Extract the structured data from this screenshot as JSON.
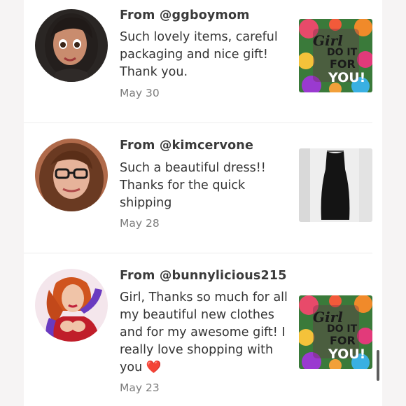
{
  "reviews": [
    {
      "from": "From @ggboymom",
      "text": "Such lovely items, careful packaging and nice gift! Thank you.",
      "date": "May 30",
      "avatar_icon": "cartoon-woman-avatar",
      "thumbnail_icon": "girl-do-it-for-you-art-thumbnail"
    },
    {
      "from": "From @kimcervone",
      "text": "Such a beautiful dress!! Thanks for the quick shipping",
      "date": "May 28",
      "avatar_icon": "woman-with-glasses-avatar",
      "thumbnail_icon": "black-dress-thumbnail"
    },
    {
      "from": "From @bunnylicious215",
      "text": "Girl, Thanks so much for all my beautiful new clothes and for my awesome gift! I really love shopping with you ❤️",
      "date": "May 23",
      "avatar_icon": "cartoon-redhead-avatar",
      "thumbnail_icon": "girl-do-it-for-you-art-thumbnail"
    }
  ],
  "art": {
    "line1": "Girl",
    "line2": "DO IT",
    "line3": "FOR",
    "line4": "YOU!"
  },
  "colors": {
    "background": "#f6f4f4",
    "panel": "#ffffff",
    "username": "#3a3a3a",
    "body_text": "#333333",
    "date": "#7c7c7c"
  }
}
